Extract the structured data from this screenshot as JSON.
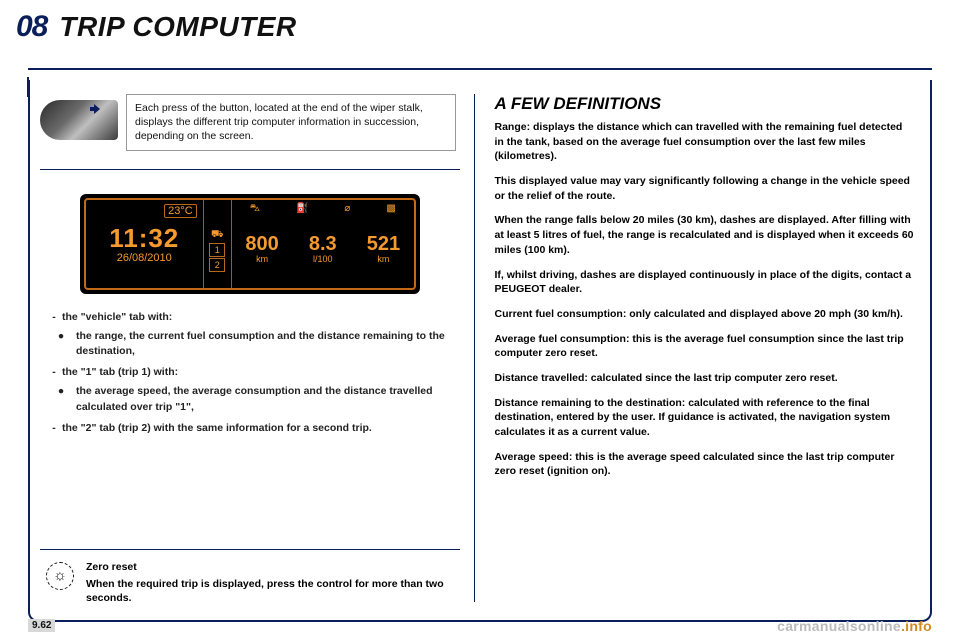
{
  "header": {
    "section_number": "08",
    "title": "TRIP COMPUTER"
  },
  "intro": {
    "callout": "Each press of the button, located at the end of the wiper stalk, displays the different trip computer information in succession, depending on the screen."
  },
  "lcd": {
    "temp": "23°C",
    "time": "11:32",
    "date": "26/08/2010",
    "tab1": "1",
    "tab2": "2",
    "car_icon": "⛍",
    "pump_icon": "⛽",
    "gauge_icon": "➤",
    "flag_icon": "⚑",
    "cells": [
      {
        "value": "800",
        "unit": "km"
      },
      {
        "value": "8.3",
        "unit": "l/100"
      },
      {
        "value": "521",
        "unit": "km"
      }
    ]
  },
  "tabs": {
    "vehicle_label": "the \"vehicle\" tab with:",
    "vehicle_bullet": "the range, the current fuel consumption and the distance remaining to the destination,",
    "trip1_label": "the \"1\" tab (trip 1) with:",
    "trip1_bullet": "the average speed, the average consumption and the distance travelled calculated over trip \"1\",",
    "trip2_label": "the \"2\" tab (trip 2) with the same information for a second trip."
  },
  "zero": {
    "title": "Zero reset",
    "body": "When the required trip is displayed, press the control for more than two seconds."
  },
  "definitions": {
    "heading": "A FEW DEFINITIONS",
    "range1": "Range: displays the distance which can travelled with the remaining fuel detected in the tank, based on the average fuel consumption over the last few miles (kilometres).",
    "range2": "This displayed value may vary significantly following a change in the vehicle speed or the relief of the route.",
    "range3": "When the range falls below 20 miles (30 km), dashes are displayed. After filling with at least 5 litres of fuel, the range is recalculated and is displayed when it exceeds 60 miles (100 km).",
    "range4": "If, whilst driving, dashes are displayed continuously in place of the digits, contact a PEUGEOT dealer.",
    "current": "Current fuel consumption: only calculated and displayed above 20 mph (30 km/h).",
    "avgfuel": "Average fuel consumption: this is the average fuel consumption since the last trip computer zero reset.",
    "dist": "Distance travelled: calculated since the last trip computer zero reset.",
    "distrem": "Distance remaining to the destination: calculated with reference to the final destination, entered by the user. If guidance is activated, the navigation system calculates it as a current value.",
    "avgspd": "Average speed: this is the average speed calculated since the last trip computer zero reset (ignition on)."
  },
  "footer": {
    "page": "9.62",
    "brand_a": "carmanualsonline",
    "brand_b": ".info"
  },
  "icons": {
    "arrow": "arrow-left-icon",
    "bulb": "💡"
  }
}
